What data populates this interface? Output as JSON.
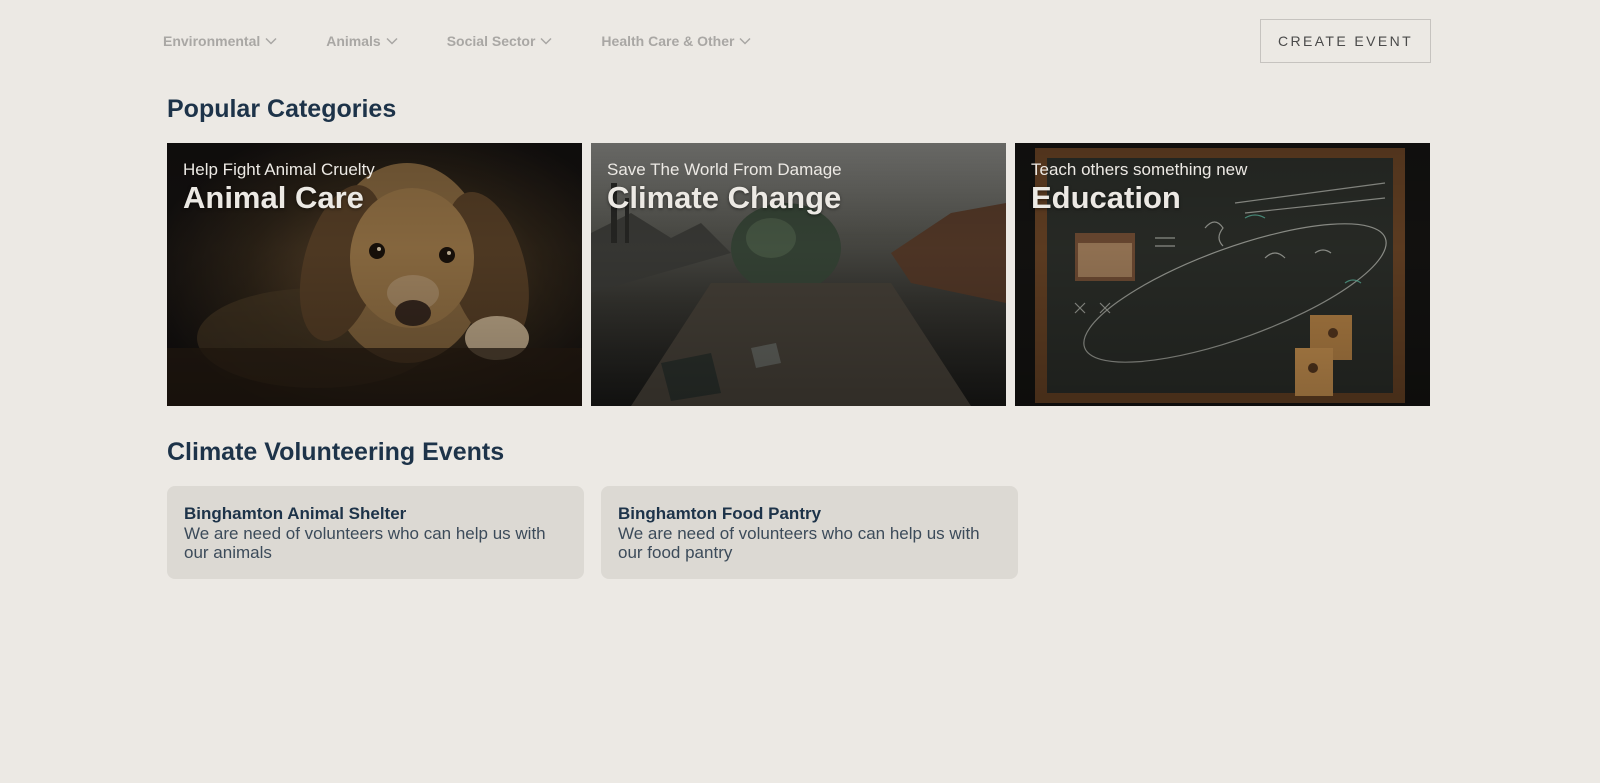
{
  "nav": {
    "items": [
      {
        "label": "Environmental"
      },
      {
        "label": "Animals"
      },
      {
        "label": "Social Sector"
      },
      {
        "label": "Health Care & Other"
      }
    ],
    "create_button": "CREATE EVENT"
  },
  "popular": {
    "title": "Popular Categories",
    "cards": [
      {
        "subtitle": "Help Fight Animal Cruelty",
        "title": "Animal Care",
        "image": "puppy-photo"
      },
      {
        "subtitle": "Save The World From Damage",
        "title": "Climate Change",
        "image": "wasteland-photo"
      },
      {
        "subtitle": "Teach others something new",
        "title": "Education",
        "image": "chalkboard-photo"
      }
    ]
  },
  "climate": {
    "title": "Climate Volunteering Events",
    "events": [
      {
        "name": "Binghamton Animal Shelter",
        "description": "We are need of volunteers who can help us with our animals"
      },
      {
        "name": "Binghamton Food Pantry",
        "description": "We are need of volunteers who can help us with our food pantry"
      }
    ]
  },
  "colors": {
    "background": "#ece9e4",
    "heading": "#1d3349",
    "nav_text": "#a9a7a4",
    "event_card": "#dcd9d3"
  }
}
